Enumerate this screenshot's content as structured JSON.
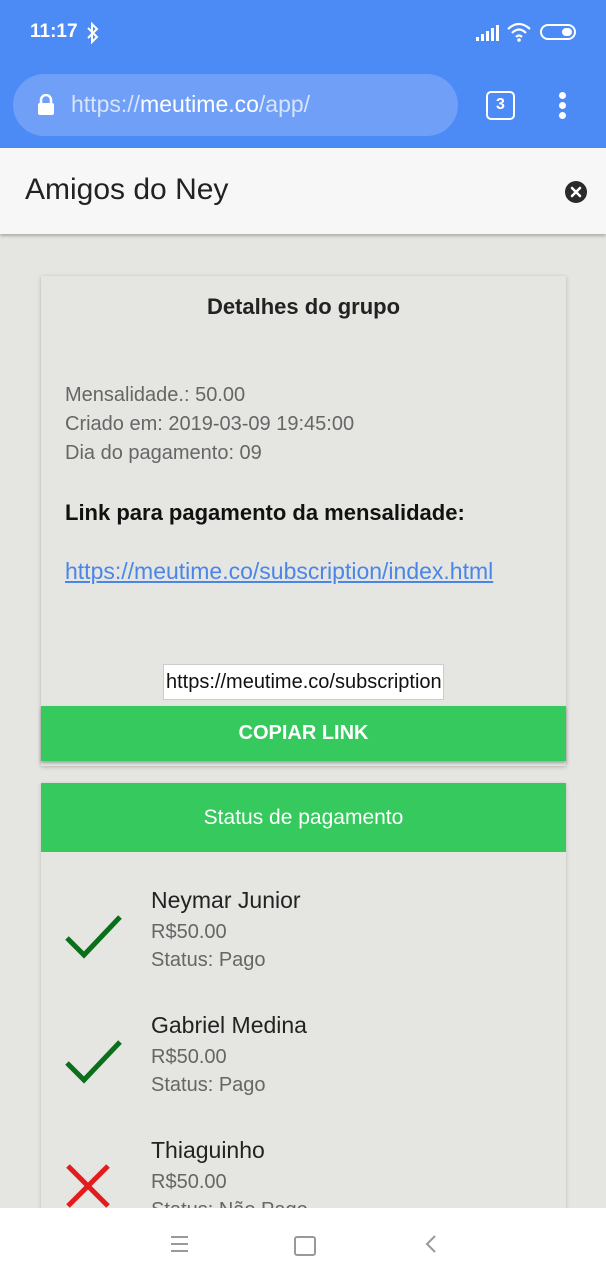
{
  "status_bar": {
    "time": "11:17",
    "icons": [
      "bluetooth-icon",
      "signal-icon",
      "wifi-icon",
      "battery-icon"
    ]
  },
  "browser": {
    "url_scheme": "https://",
    "url_host": "meutime.co",
    "url_path": "/app/",
    "tab_count": "3",
    "icons": [
      "lock-icon",
      "overflow-menu-icon"
    ]
  },
  "header": {
    "title": "Amigos do Ney",
    "icon": "close-icon"
  },
  "group_details": {
    "title": "Detalhes do grupo",
    "monthly_fee": "Mensalidade.: 50.00",
    "created_at": "Criado em: 2019-03-09 19:45:00",
    "payment_day": "Dia do pagamento: 09",
    "link_heading": "Link para pagamento da mensalidade:",
    "link_text": "https://meutime.co/subscription/index.html",
    "link_input_value": "https://meutime.co/subscription/index.html",
    "copy_button_label": "COPIAR LINK"
  },
  "payment_status": {
    "header": "Status de pagamento",
    "members": [
      {
        "name": "Neymar Junior",
        "amount": "R$50.00",
        "status": "Status: Pago",
        "paid": true
      },
      {
        "name": "Gabriel Medina",
        "amount": "R$50.00",
        "status": "Status: Pago",
        "paid": true
      },
      {
        "name": "Thiaguinho",
        "amount": "R$50.00",
        "status": "Status: Não Pago",
        "paid": false
      }
    ]
  },
  "colors": {
    "chrome_blue": "#4c8bf5",
    "accent_green": "#35c95e",
    "paid_check": "#0b6e1a",
    "unpaid_x": "#e21c1c",
    "link_blue": "#4a86e8"
  },
  "nav_bar": {
    "icons": [
      "recents-icon",
      "home-icon",
      "back-icon"
    ]
  }
}
